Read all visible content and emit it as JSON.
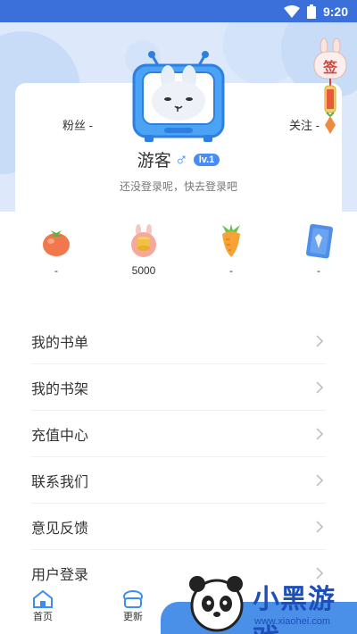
{
  "status_bar": {
    "time": "9:20"
  },
  "profile": {
    "fans_label": "粉丝 -",
    "follow_label": "关注 -",
    "username": "游客",
    "gender_symbol": "♂",
    "level": "lv.1",
    "login_hint": "还没登录呢，快去登录吧"
  },
  "sign_widget": {
    "label": "签"
  },
  "stats": [
    {
      "icon": "tomato-icon",
      "value": "-"
    },
    {
      "icon": "coin-stack-icon",
      "value": "5000"
    },
    {
      "icon": "carrot-icon",
      "value": "-"
    },
    {
      "icon": "card-icon",
      "value": "-"
    }
  ],
  "menu": [
    {
      "label": "我的书单"
    },
    {
      "label": "我的书架"
    },
    {
      "label": "充值中心"
    },
    {
      "label": "联系我们"
    },
    {
      "label": "意见反馈"
    },
    {
      "label": "用户登录"
    }
  ],
  "bottom_nav": [
    {
      "label": "首页",
      "icon": "home-icon"
    },
    {
      "label": "更新",
      "icon": "update-icon"
    }
  ],
  "watermark": {
    "text": "小黑游戏",
    "url": "www.xiaohei.com"
  },
  "colors": {
    "accent": "#3b6fd9",
    "header_bg": "#dde9fb",
    "badge": "#4a8df2"
  }
}
